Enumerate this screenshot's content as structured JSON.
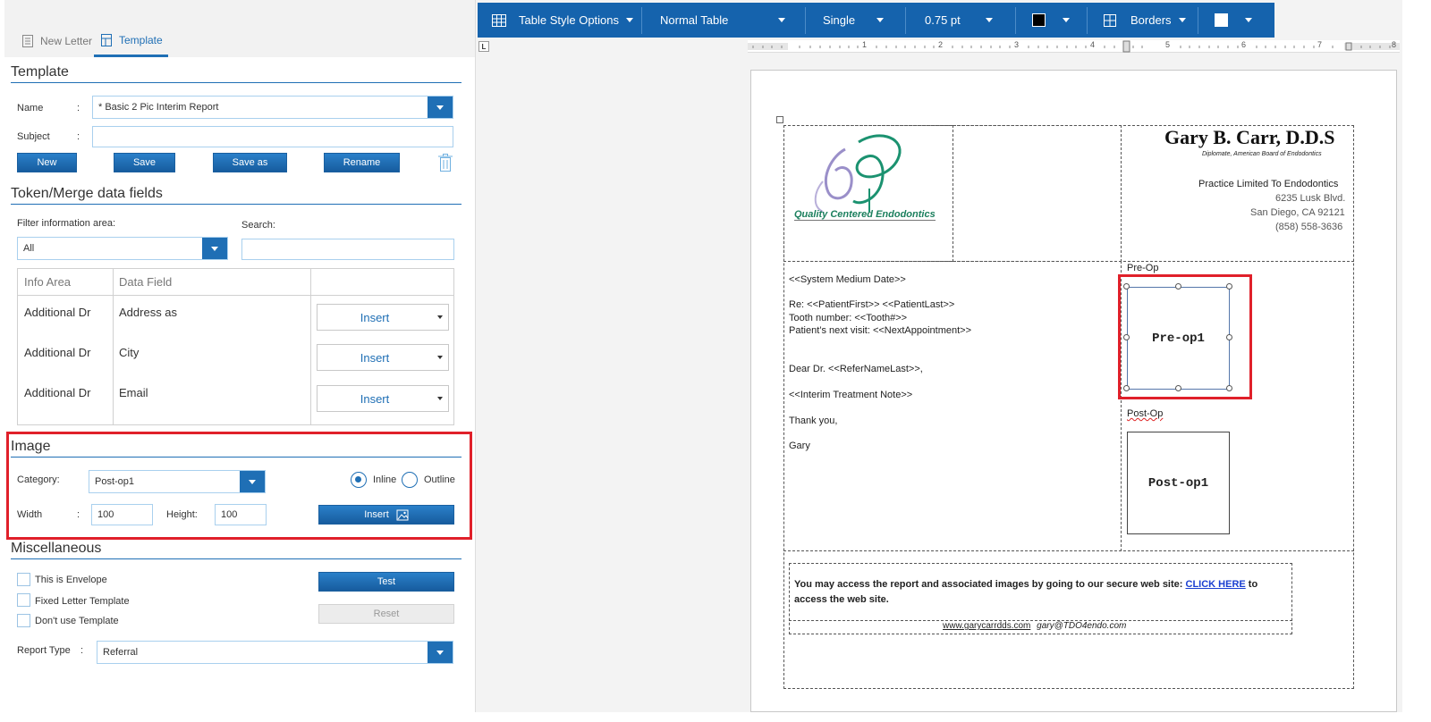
{
  "left_tabs": [
    {
      "label": "New Letter",
      "icon": "document-icon"
    },
    {
      "label": "Template",
      "icon": "template-icon"
    }
  ],
  "template": {
    "title": "Template",
    "name_label": "Name",
    "colon": ":",
    "name_value": "* Basic 2 Pic Interim Report",
    "subject_label": "Subject",
    "subject_value": "",
    "buttons": {
      "new": "New",
      "save": "Save",
      "save_as": "Save as",
      "rename": "Rename"
    }
  },
  "tokens": {
    "title": "Token/Merge data fields",
    "filter_label": "Filter information area:",
    "filter_value": "All",
    "search_label": "Search:",
    "search_value": "",
    "columns": [
      "Info Area",
      "Data Field",
      ""
    ],
    "rows": [
      {
        "area": "Additional Dr",
        "field": "Address as",
        "action": "Insert"
      },
      {
        "area": "Additional Dr",
        "field": "City",
        "action": "Insert"
      },
      {
        "area": "Additional Dr",
        "field": "Email",
        "action": "Insert"
      }
    ]
  },
  "image": {
    "title": "Image",
    "category_label": "Category:",
    "category_value": "Post-op1",
    "inline_label": "Inline",
    "outline_label": "Outline",
    "width_label": "Width",
    "width_value": "100",
    "height_label": "Height:",
    "height_value": "100",
    "insert_label": "Insert"
  },
  "misc": {
    "title": "Miscellaneous",
    "checkboxes": [
      "This is Envelope",
      "Fixed Letter Template",
      "Don't use Template"
    ],
    "test_label": "Test",
    "reset_label": "Reset",
    "report_type_label": "Report Type",
    "report_type_value": "Referral"
  },
  "toolbar": {
    "table_style": "Table Style Options",
    "normal_table": "Normal Table",
    "line_style": "Single",
    "line_weight": "0.75 pt",
    "borders": "Borders"
  },
  "ruler": {
    "corner": "L",
    "marks": [
      "1",
      "2",
      "3",
      "4",
      "5",
      "6",
      "7",
      "8"
    ]
  },
  "doc": {
    "logo_text": "Quality Centered Endodontics",
    "doctor_name": "Gary B. Carr, D.D.S",
    "diplomate": "Diplomate, American Board of Endodontics",
    "practice": "Practice Limited To Endodontics",
    "address1": "6235 Lusk Blvd.",
    "address2": "San Diego, CA 92121",
    "phone": "(858) 558-3636",
    "date_token": "<<System Medium Date>>",
    "re_line": "Re: <<PatientFirst>> <<PatientLast>>",
    "tooth_line": "Tooth number: <<Tooth#>>",
    "next_visit": "Patient’s next visit: <<NextAppointment>>",
    "dear": "Dear Dr. <<ReferNameLast>>,",
    "note_token": "<<Interim Treatment Note>>",
    "thanks": "Thank you,",
    "sign": "Gary",
    "preop_label": "Pre-Op",
    "preop_img": "Pre-op1",
    "postop_label": "Post-Op",
    "postop_img": "Post-op1",
    "footer_text": "You may access the report and associated images by going to our secure web site:",
    "footer_link": "CLICK HERE",
    "footer_to": "to",
    "footer_text2": "access the web site.",
    "website": "www.garycarrdds.com",
    "email": "gary@TDO4endo.com"
  },
  "colors": {
    "accent": "#1f6fb5",
    "toolbar": "#1563ad",
    "highlight": "#e0202a"
  }
}
